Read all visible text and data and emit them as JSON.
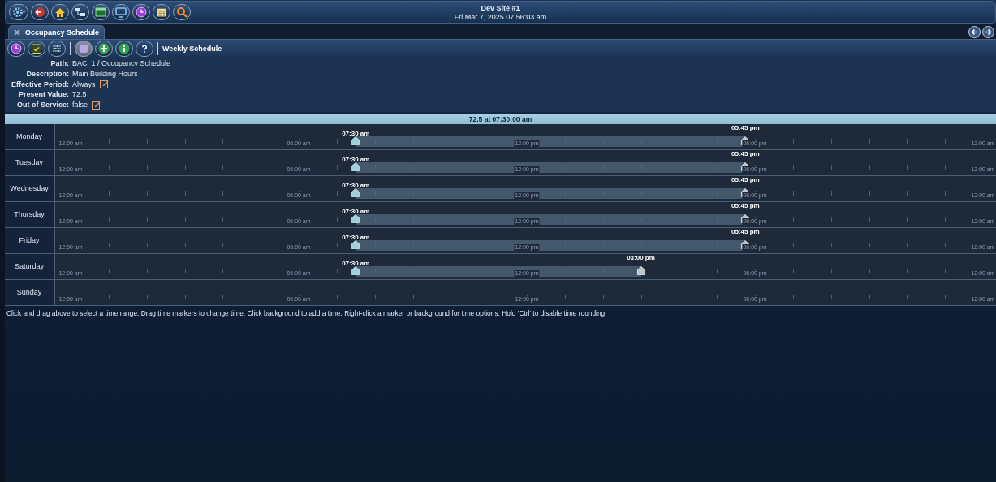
{
  "header": {
    "title": "Dev Site #1",
    "datetime": "Fri Mar 7, 2025 07:56:03 am"
  },
  "tabs": [
    {
      "label": "Occupancy Schedule",
      "selected": true
    }
  ],
  "toolbar": {
    "buttons": [
      {
        "disabled": false
      },
      {
        "disabled": false
      },
      {
        "disabled": false
      },
      {
        "disabled": true
      },
      {
        "disabled": false
      },
      {
        "disabled": false
      },
      {
        "disabled": false
      }
    ],
    "title": "Weekly Schedule"
  },
  "properties": [
    {
      "label": "Path:",
      "value": "BAC_1 / Occupancy Schedule",
      "editable": false
    },
    {
      "label": "Description:",
      "value": "Main Building Hours",
      "editable": false
    },
    {
      "label": "Effective Period:",
      "value": "Always",
      "editable": true
    },
    {
      "label": "Present Value:",
      "value": "72.5",
      "editable": false
    },
    {
      "label": "Out of Service:",
      "value": "false",
      "editable": true
    }
  ],
  "schedule": {
    "current_value": "72.5 at 07:30:00 am",
    "days": [
      {
        "name": "Monday",
        "axis_labels": [
          "12:00 am",
          "06:00 am",
          "12:00 pm",
          "06:00 pm",
          "12:00 am"
        ],
        "periods": [
          {
            "start": {
              "time": "07:30 am",
              "level": 0.3125
            },
            "end": {
              "time": "05:45 pm",
              "level": 0.7396
            }
          }
        ]
      },
      {
        "name": "Tuesday",
        "axis_labels": [
          "12:00 am",
          "06:00 am",
          "12:00 pm",
          "06:00 pm",
          "12:00 am"
        ],
        "periods": [
          {
            "start": {
              "time": "07:30 am",
              "level": 0.3125
            },
            "end": {
              "time": "05:45 pm",
              "level": 0.7396
            }
          }
        ]
      },
      {
        "name": "Wednesday",
        "axis_labels": [
          "12:00 am",
          "06:00 am",
          "12:00 pm",
          "06:00 pm",
          "12:00 am"
        ],
        "periods": [
          {
            "start": {
              "time": "07:30 am",
              "level": 0.3125
            },
            "end": {
              "time": "05:45 pm",
              "level": 0.7396
            }
          }
        ]
      },
      {
        "name": "Thursday",
        "axis_labels": [
          "12:00 am",
          "06:00 am",
          "12:00 pm",
          "06:00 pm",
          "12:00 am"
        ],
        "periods": [
          {
            "start": {
              "time": "07:30 am",
              "level": 0.3125
            },
            "end": {
              "time": "05:45 pm",
              "level": 0.7396
            }
          }
        ]
      },
      {
        "name": "Friday",
        "axis_labels": [
          "12:00 am",
          "06:00 am",
          "12:00 pm",
          "06:00 pm",
          "12:00 am"
        ],
        "periods": [
          {
            "start": {
              "time": "07:30 am",
              "level": 0.3125
            },
            "end": {
              "time": "05:45 pm",
              "level": 0.7396
            }
          }
        ]
      },
      {
        "name": "Saturday",
        "axis_labels": [
          "12:00 am",
          "06:00 am",
          "12:00 pm",
          "06:00 pm",
          "12:00 am"
        ],
        "periods": [
          {
            "start": {
              "time": "07:30 am",
              "level": 0.3125
            },
            "end": {
              "time": "03:00 pm",
              "level": 0.625
            }
          }
        ]
      },
      {
        "name": "Sunday",
        "axis_labels": [
          "12:00 am",
          "06:00 am",
          "12:00 pm",
          "06:00 pm",
          "12:00 am"
        ]
      }
    ]
  },
  "hint": "Click and drag above to select a time range. Drag time markers to change time. Click background to add a time. Right-click a marker or background for time options. Hold 'Ctrl' to disable time rounding."
}
